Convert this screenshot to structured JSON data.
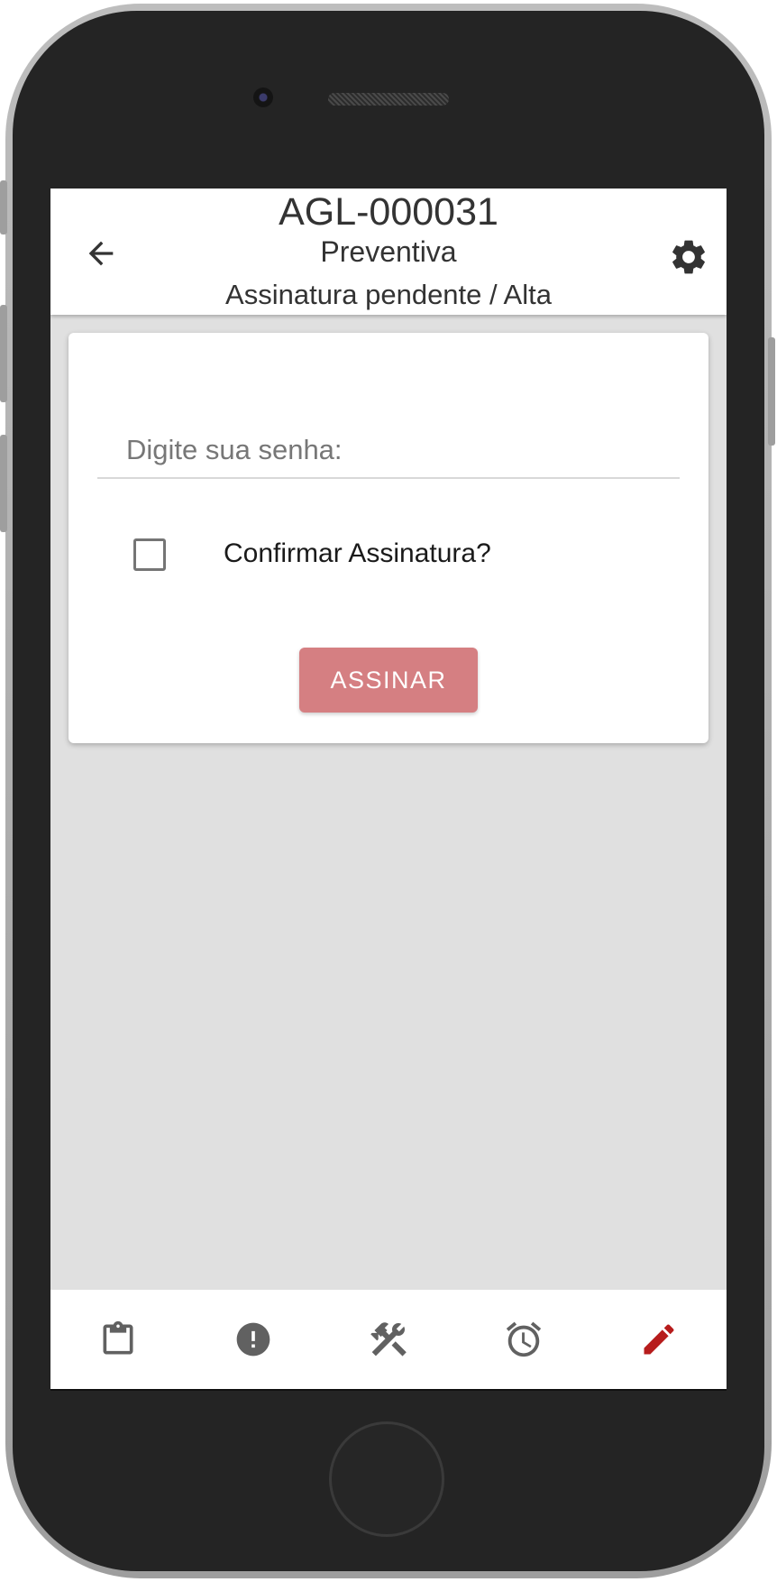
{
  "header": {
    "code": "AGL-000031",
    "type": "Preventiva",
    "status": "Assinatura pendente / Alta"
  },
  "form": {
    "password_placeholder": "Digite sua senha:",
    "confirm_label": "Confirmar Assinatura?",
    "confirm_checked": false,
    "sign_button_label": "ASSINAR"
  },
  "bottom_nav": {
    "items": [
      {
        "icon": "clipboard-icon",
        "active": false
      },
      {
        "icon": "alert-icon",
        "active": false
      },
      {
        "icon": "tools-icon",
        "active": false
      },
      {
        "icon": "alarm-clock-icon",
        "active": false
      },
      {
        "icon": "pencil-icon",
        "active": true
      }
    ]
  },
  "colors": {
    "accent": "#b71c1c",
    "button_disabled": "#d57f82",
    "icon_inactive": "#616161",
    "background": "#e0e0e0"
  }
}
